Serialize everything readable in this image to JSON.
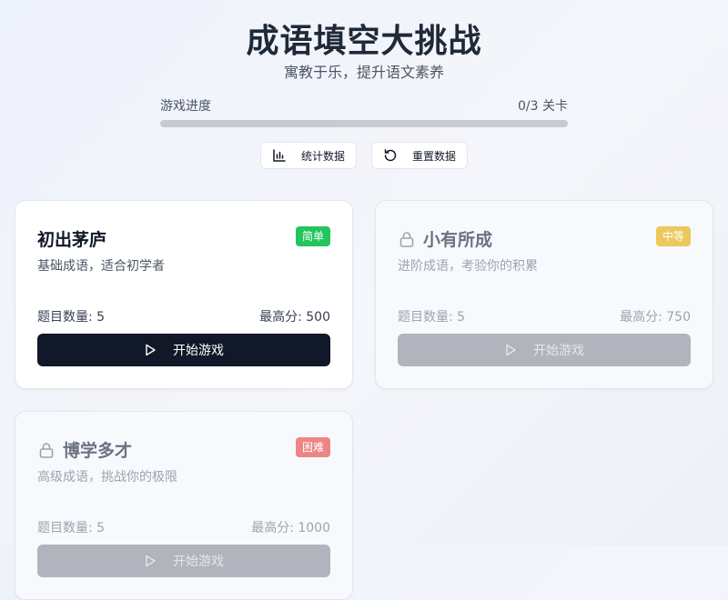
{
  "header": {
    "title": "成语填空大挑战",
    "subtitle": "寓教于乐，提升语文素养"
  },
  "progress": {
    "label": "游戏进度",
    "count_text": "0/3 关卡",
    "completed": 0,
    "total": 3
  },
  "toolbar": {
    "stats_label": "统计数据",
    "reset_label": "重置数据"
  },
  "levels": [
    {
      "name": "初出茅庐",
      "difficulty": "简单",
      "description": "基础成语，适合初学者",
      "question_count": "题目数量: 5",
      "high_score": "最高分: 500",
      "button_label": "开始游戏",
      "locked": false
    },
    {
      "name": "小有所成",
      "difficulty": "中等",
      "description": "进阶成语，考验你的积累",
      "question_count": "题目数量: 5",
      "high_score": "最高分: 750",
      "button_label": "开始游戏",
      "locked": true
    },
    {
      "name": "博学多才",
      "difficulty": "困难",
      "description": "高级成语，挑战你的极限",
      "question_count": "题目数量: 5",
      "high_score": "最高分: 1000",
      "button_label": "开始游戏",
      "locked": true
    }
  ],
  "colors": {
    "easy": "#22c55e",
    "medium": "#ebc95a",
    "hard": "#ee8585",
    "primary": "#111827"
  },
  "icons": {
    "stats": "bar-chart-icon",
    "reset": "refresh-icon",
    "lock": "lock-icon",
    "play": "play-icon"
  }
}
